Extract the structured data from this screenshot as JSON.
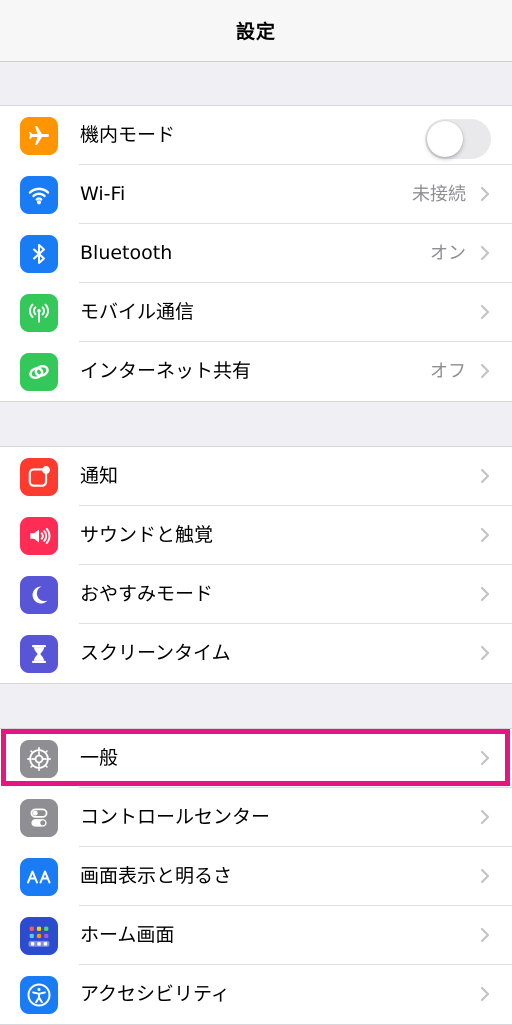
{
  "navbar": {
    "title": "設定"
  },
  "accent_highlight_color": "#e6157f",
  "groups": [
    {
      "rows": [
        {
          "label": "機内モード",
          "icon": "airplane-icon",
          "icon_color": "#ff9500",
          "toggle": "off"
        },
        {
          "label": "Wi-Fi",
          "icon": "wifi-icon",
          "icon_color": "#1a7cf5",
          "value": "未接続"
        },
        {
          "label": "Bluetooth",
          "icon": "bluetooth-icon",
          "icon_color": "#1a7cf5",
          "value": "オン"
        },
        {
          "label": "モバイル通信",
          "icon": "antenna-icon",
          "icon_color": "#34c759"
        },
        {
          "label": "インターネット共有",
          "icon": "link-icon",
          "icon_color": "#34c759",
          "value": "オフ"
        }
      ]
    },
    {
      "rows": [
        {
          "label": "通知",
          "icon": "notification-icon",
          "icon_color": "#ff3b30"
        },
        {
          "label": "サウンドと触覚",
          "icon": "speaker-icon",
          "icon_color": "#ff2d55"
        },
        {
          "label": "おやすみモード",
          "icon": "moon-icon",
          "icon_color": "#5856d6"
        },
        {
          "label": "スクリーンタイム",
          "icon": "hourglass-icon",
          "icon_color": "#5856d6"
        }
      ]
    },
    {
      "rows": [
        {
          "label": "一般",
          "icon": "gear-icon",
          "icon_color": "#8e8e93"
        },
        {
          "label": "コントロールセンター",
          "icon": "switches-icon",
          "icon_color": "#8e8e93"
        },
        {
          "label": "画面表示と明るさ",
          "icon": "text-size-icon",
          "icon_color": "#1a7cf5"
        },
        {
          "label": "ホーム画面",
          "icon": "home-grid-icon",
          "icon_color": "#2c4ccf"
        },
        {
          "label": "アクセシビリティ",
          "icon": "accessibility-icon",
          "icon_color": "#1a7cf5"
        }
      ]
    }
  ]
}
